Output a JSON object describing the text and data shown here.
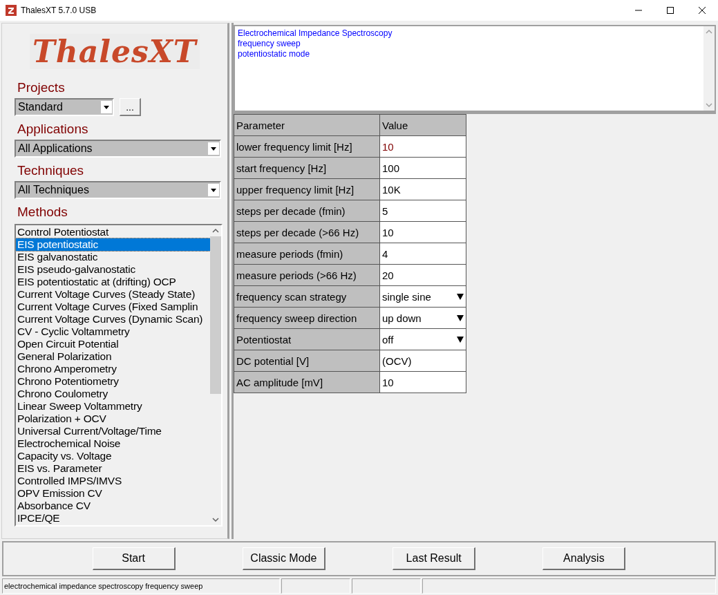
{
  "window": {
    "title": "ThalesXT 5.7.0 USB"
  },
  "logo": {
    "text": "ThalesXT"
  },
  "projects": {
    "label": "Projects",
    "value": "Standard",
    "browse": "..."
  },
  "applications": {
    "label": "Applications",
    "value": "All Applications"
  },
  "techniques": {
    "label": "Techniques",
    "value": "All Techniques"
  },
  "methods": {
    "label": "Methods",
    "items": [
      {
        "label": "Control Potentiostat",
        "selected": false
      },
      {
        "label": "EIS potentiostatic",
        "selected": true
      },
      {
        "label": "EIS galvanostatic",
        "selected": false
      },
      {
        "label": "EIS pseudo-galvanostatic",
        "selected": false
      },
      {
        "label": "EIS potentiostatic at (drifting) OCP",
        "selected": false
      },
      {
        "label": "Current Voltage Curves (Steady State)",
        "selected": false
      },
      {
        "label": "Current Voltage Curves (Fixed Samplin",
        "selected": false
      },
      {
        "label": "Current Voltage Curves (Dynamic Scan)",
        "selected": false
      },
      {
        "label": "CV - Cyclic Voltammetry",
        "selected": false
      },
      {
        "label": "Open Circuit Potential",
        "selected": false
      },
      {
        "label": "General Polarization",
        "selected": false
      },
      {
        "label": "Chrono Amperometry",
        "selected": false
      },
      {
        "label": "Chrono Potentiometry",
        "selected": false
      },
      {
        "label": "Chrono Coulometry",
        "selected": false
      },
      {
        "label": "Linear Sweep Voltammetry",
        "selected": false
      },
      {
        "label": "Polarization + OCV",
        "selected": false
      },
      {
        "label": "Universal Current/Voltage/Time",
        "selected": false
      },
      {
        "label": "Electrochemical Noise",
        "selected": false
      },
      {
        "label": "Capacity vs. Voltage",
        "selected": false
      },
      {
        "label": "EIS vs. Parameter",
        "selected": false
      },
      {
        "label": "Controlled IMPS/IMVS",
        "selected": false
      },
      {
        "label": "OPV Emission CV",
        "selected": false
      },
      {
        "label": "Absorbance CV",
        "selected": false
      },
      {
        "label": "IPCE/QE",
        "selected": false
      }
    ]
  },
  "description": {
    "lines": [
      "Electrochemical Impedance Spectroscopy",
      "frequency sweep",
      "potentiostatic mode"
    ]
  },
  "parameters": {
    "columns": [
      "Parameter",
      "Value"
    ],
    "rows": [
      {
        "name": "lower frequency limit [Hz]",
        "value": "10",
        "kind": "text",
        "changed": true
      },
      {
        "name": "start frequency [Hz]",
        "value": "100",
        "kind": "text",
        "changed": false
      },
      {
        "name": "upper frequency limit [Hz]",
        "value": "10K",
        "kind": "text",
        "changed": false
      },
      {
        "name": "steps per decade (fmin)",
        "value": "5",
        "kind": "text",
        "changed": false
      },
      {
        "name": "steps per decade (>66 Hz)",
        "value": "10",
        "kind": "text",
        "changed": false
      },
      {
        "name": "measure periods (fmin)",
        "value": "4",
        "kind": "text",
        "changed": false
      },
      {
        "name": "measure periods (>66 Hz)",
        "value": "20",
        "kind": "text",
        "changed": false
      },
      {
        "name": "frequency scan strategy",
        "value": "single sine",
        "kind": "dropdown",
        "changed": false
      },
      {
        "name": "frequency sweep direction",
        "value": "up down",
        "kind": "dropdown",
        "changed": false
      },
      {
        "name": "Potentiostat",
        "value": "off",
        "kind": "dropdown",
        "changed": false
      },
      {
        "name": "DC potential [V]",
        "value": "(OCV)",
        "kind": "text",
        "changed": false
      },
      {
        "name": "AC amplitude [mV]",
        "value": "10",
        "kind": "text",
        "changed": false
      }
    ]
  },
  "buttons": [
    "Start",
    "Classic Mode",
    "Last Result",
    "Analysis"
  ],
  "status_bar": {
    "text": "electrochemical impedance spectroscopy frequency sweep"
  }
}
